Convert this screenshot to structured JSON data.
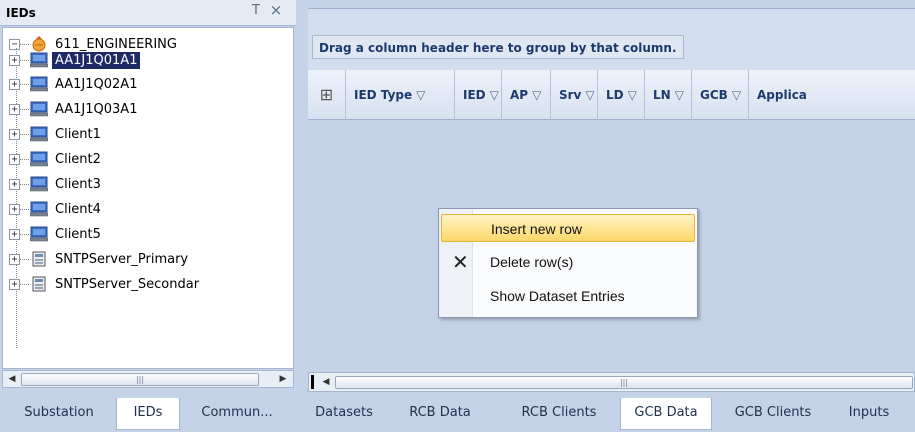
{
  "left_panel": {
    "title": "IEDs",
    "pin_glyph": "Т",
    "close_glyph": "×",
    "root": {
      "label": "611_ENGINEERING",
      "expander": "−"
    },
    "items": [
      {
        "label": "AA1J1Q01A1",
        "selected": true,
        "icon": "computer-icon"
      },
      {
        "label": "AA1J1Q02A1",
        "selected": false,
        "icon": "computer-icon"
      },
      {
        "label": "AA1J1Q03A1",
        "selected": false,
        "icon": "computer-icon"
      },
      {
        "label": "Client1",
        "selected": false,
        "icon": "computer-icon"
      },
      {
        "label": "Client2",
        "selected": false,
        "icon": "computer-icon"
      },
      {
        "label": "Client3",
        "selected": false,
        "icon": "computer-icon"
      },
      {
        "label": "Client4",
        "selected": false,
        "icon": "computer-icon"
      },
      {
        "label": "Client5",
        "selected": false,
        "icon": "computer-icon"
      },
      {
        "label": "SNTPServer_Primary",
        "selected": false,
        "icon": "server-icon"
      },
      {
        "label": "SNTPServer_Secondar",
        "selected": false,
        "icon": "server-icon"
      }
    ],
    "expander_plus": "+",
    "scroll_grip": "|||",
    "scroll_left": "◀",
    "scroll_right": "▶",
    "tabs": [
      {
        "label": "Substation",
        "active": false
      },
      {
        "label": "IEDs",
        "active": true
      },
      {
        "label": "Commun...",
        "active": false
      }
    ]
  },
  "grid": {
    "group_hint": "Drag a column header here to group by that column.",
    "grid_glyph": "⊞",
    "filter_glyph": "▽",
    "columns": [
      "IED Type",
      "IED",
      "AP",
      "Srv",
      "LD",
      "LN",
      "GCB",
      "Applica"
    ],
    "scroll_grip": "|||",
    "scroll_left": "◀",
    "tabs": [
      {
        "label": "Datasets",
        "active": false
      },
      {
        "label": "RCB Data",
        "active": false
      },
      {
        "label": "RCB Clients",
        "active": false
      },
      {
        "label": "GCB Data",
        "active": true
      },
      {
        "label": "GCB Clients",
        "active": false
      },
      {
        "label": "Inputs",
        "active": false
      }
    ]
  },
  "context_menu": {
    "items": [
      {
        "label": "Insert new row",
        "highlighted": true
      },
      {
        "label": "Delete row(s)",
        "highlighted": false,
        "icon": "delete-x-icon"
      },
      {
        "label": "Show Dataset Entries",
        "highlighted": false
      }
    ],
    "delete_glyph": "✕"
  }
}
